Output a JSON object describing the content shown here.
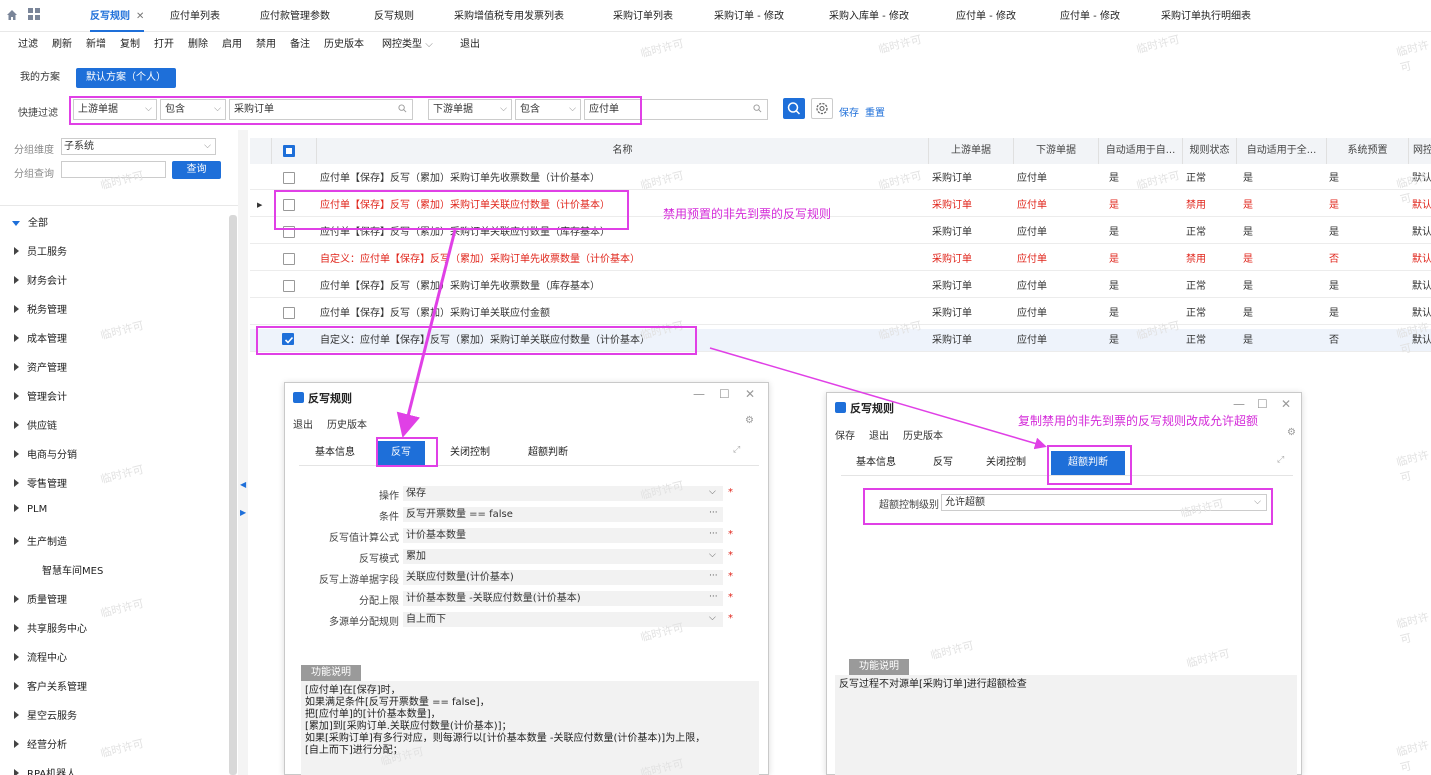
{
  "tabs": [
    {
      "label": "反写规则",
      "active": true
    },
    {
      "label": "应付单列表"
    },
    {
      "label": "应付款管理参数"
    },
    {
      "label": "反写规则"
    },
    {
      "label": "采购增值税专用发票列表"
    },
    {
      "label": "采购订单列表"
    },
    {
      "label": "采购订单 - 修改"
    },
    {
      "label": "采购入库单 - 修改"
    },
    {
      "label": "应付单 - 修改"
    },
    {
      "label": "应付单 - 修改"
    },
    {
      "label": "采购订单执行明细表"
    }
  ],
  "toolbar": [
    "过滤",
    "刷新",
    "新增",
    "复制",
    "打开",
    "删除",
    "启用",
    "禁用",
    "备注",
    "历史版本",
    "网控类型",
    "退出"
  ],
  "schemes": {
    "mine": "我的方案",
    "default": "默认方案（个人）"
  },
  "quick_filter": {
    "label": "快捷过滤",
    "field1": "上游单据",
    "op1": "包含",
    "value1": "采购订单",
    "field2": "下游单据",
    "op2": "包含",
    "value2": "应付单",
    "save": "保存",
    "reset": "重置"
  },
  "left_panel": {
    "group_dim_label": "分组维度",
    "group_dim_value": "子系统",
    "group_query_label": "分组查询",
    "query_button": "查询",
    "tree": [
      "全部",
      "员工服务",
      "财务会计",
      "税务管理",
      "成本管理",
      "资产管理",
      "管理会计",
      "供应链",
      "电商与分销",
      "零售管理",
      "PLM",
      "生产制造",
      "智慧车间MES",
      "质量管理",
      "共享服务中心",
      "流程中心",
      "客户关系管理",
      "星空云服务",
      "经营分析",
      "RPA机器人"
    ]
  },
  "grid": {
    "headers": [
      "名称",
      "上游单据",
      "下游单据",
      "自动适用于自...",
      "规则状态",
      "自动适用于全...",
      "系统预置",
      "网控"
    ],
    "rows": [
      {
        "name": "应付单【保存】反写（累加）采购订单先收票数量（计价基本）",
        "up": "采购订单",
        "down": "应付单",
        "auto1": "是",
        "status": "正常",
        "auto2": "是",
        "preset": "是",
        "net": "默认",
        "red": false,
        "checked": false
      },
      {
        "name": "应付单【保存】反写（累加）采购订单关联应付数量（计价基本）",
        "up": "采购订单",
        "down": "应付单",
        "auto1": "是",
        "status": "禁用",
        "auto2": "是",
        "preset": "是",
        "net": "默认",
        "red": true,
        "checked": false
      },
      {
        "name": "应付单【保存】反写（累加）采购订单关联应付数量（库存基本）",
        "up": "采购订单",
        "down": "应付单",
        "auto1": "是",
        "status": "正常",
        "auto2": "是",
        "preset": "是",
        "net": "默认",
        "red": false,
        "checked": false
      },
      {
        "name": "自定义：应付单【保存】反写（累加）采购订单先收票数量（计价基本）",
        "up": "采购订单",
        "down": "应付单",
        "auto1": "是",
        "status": "禁用",
        "auto2": "是",
        "preset": "否",
        "net": "默认",
        "red": true,
        "checked": false
      },
      {
        "name": "应付单【保存】反写（累加）采购订单先收票数量（库存基本）",
        "up": "采购订单",
        "down": "应付单",
        "auto1": "是",
        "status": "正常",
        "auto2": "是",
        "preset": "是",
        "net": "默认",
        "red": false,
        "checked": false
      },
      {
        "name": "应付单【保存】反写（累加）采购订单关联应付金额",
        "up": "采购订单",
        "down": "应付单",
        "auto1": "是",
        "status": "正常",
        "auto2": "是",
        "preset": "是",
        "net": "默认",
        "red": false,
        "checked": false
      },
      {
        "name": "自定义：应付单【保存】反写（累加）采购订单关联应付数量（计价基本）",
        "up": "采购订单",
        "down": "应付单",
        "auto1": "是",
        "status": "正常",
        "auto2": "是",
        "preset": "否",
        "net": "默认",
        "red": false,
        "checked": true
      }
    ]
  },
  "dialog1": {
    "title": "反写规则",
    "menu": [
      "退出",
      "历史版本"
    ],
    "tabs": [
      "基本信息",
      "反写",
      "关闭控制",
      "超额判断"
    ],
    "active_tab": 1,
    "fields": [
      {
        "label": "操作",
        "value": "保存",
        "kind": "select",
        "required": true
      },
      {
        "label": "条件",
        "value": "反写开票数量 == false",
        "kind": "dots",
        "required": false
      },
      {
        "label": "反写值计算公式",
        "value": "计价基本数量",
        "kind": "dots",
        "required": true
      },
      {
        "label": "反写模式",
        "value": "累加",
        "kind": "select",
        "required": true
      },
      {
        "label": "反写上游单据字段",
        "value": "关联应付数量(计价基本)",
        "kind": "dots",
        "required": true
      },
      {
        "label": "分配上限",
        "value": "计价基本数量 -关联应付数量(计价基本)",
        "kind": "dots",
        "required": true
      },
      {
        "label": "多源单分配规则",
        "value": "自上而下",
        "kind": "select",
        "required": true
      }
    ],
    "func_title": "功能说明",
    "func_text": "[应付单]在[保存]时，\n如果满足条件[反写开票数量 == false]，\n把[应付单]的[计价基本数量]，\n[累加]到[采购订单.关联应付数量(计价基本)]；\n如果[采购订单]有多行对应，则每源行以[计价基本数量 -关联应付数量(计价基本)]为上限，\n[自上而下]进行分配；"
  },
  "dialog2": {
    "title": "反写规则",
    "menu": [
      "保存",
      "退出",
      "历史版本"
    ],
    "tabs": [
      "基本信息",
      "反写",
      "关闭控制",
      "超额判断"
    ],
    "active_tab": 3,
    "field_label": "超额控制级别",
    "field_value": "允许超额",
    "func_title": "功能说明",
    "func_text": "反写过程不对源单[采购订单]进行超额检查"
  },
  "annotations": {
    "a1": "禁用预置的非先到票的反写规则",
    "a2": "复制禁用的非先到票的反写规则改成允许超额"
  },
  "watermark": "临时许可",
  "colors": {
    "accent": "#1e6fd9",
    "annotation": "#e040e6",
    "error": "#e0251b"
  }
}
